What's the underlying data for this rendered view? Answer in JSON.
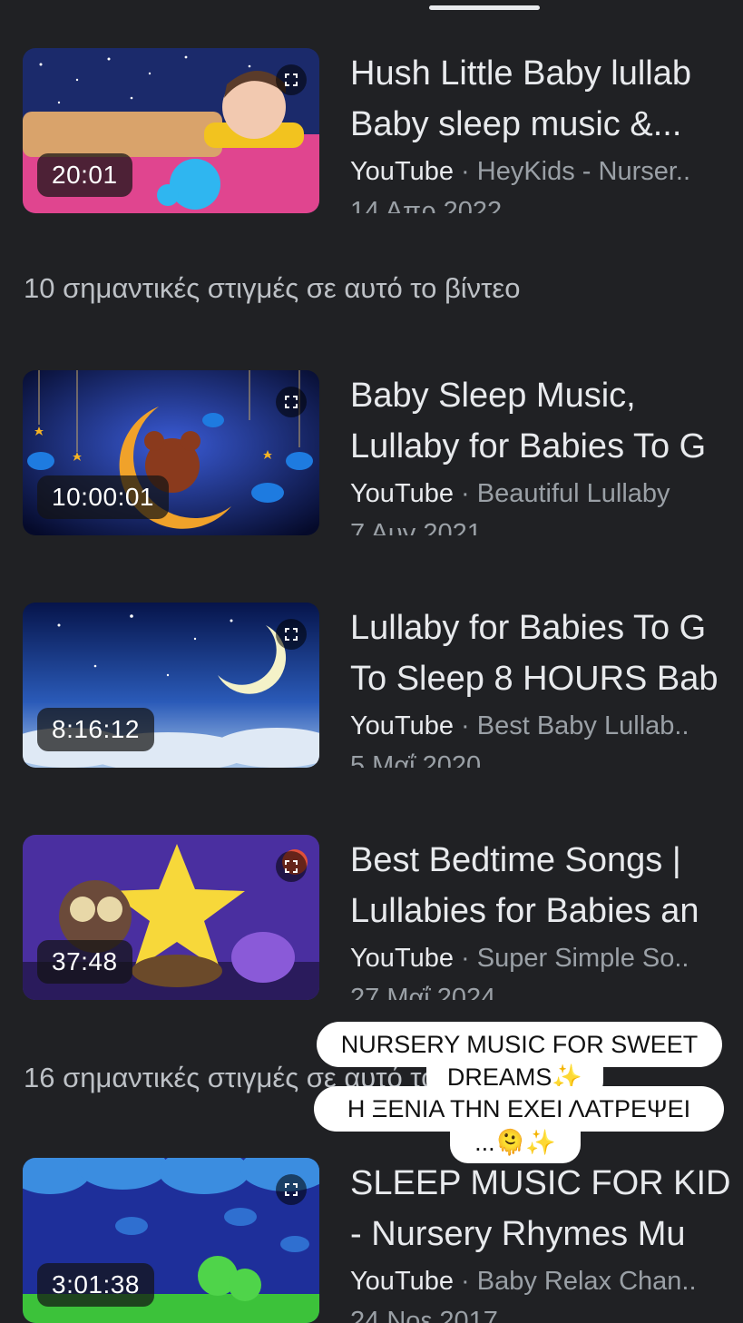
{
  "colors": {
    "background": "#202124",
    "title_text": "#e8eaed",
    "secondary_text": "#9aa0a6"
  },
  "icons": {
    "expand": "fullscreen-expand-icon"
  },
  "results": [
    {
      "duration": "20:01",
      "title_line1": "Hush Little Baby lullab",
      "title_line2": "Baby sleep music &...",
      "source": "YouTube",
      "channel": "· HeyKids - Nurser..",
      "date": "14 Απρ 2022"
    },
    {
      "duration": "10:00:01",
      "title_line1": "Baby Sleep Music,",
      "title_line2": "Lullaby for Babies To G",
      "source": "YouTube",
      "channel": "· Beautiful Lullaby",
      "date": "7 Αυγ 2021"
    },
    {
      "duration": "8:16:12",
      "title_line1": "Lullaby for Babies To G",
      "title_line2": "To Sleep 8 HOURS Bab",
      "source": "YouTube",
      "channel": "· Best Baby Lullab..",
      "date": "5 Μαΐ 2020"
    },
    {
      "duration": "37:48",
      "title_line1": "Best Bedtime Songs |",
      "title_line2": "Lullabies for Babies an",
      "source": "YouTube",
      "channel": "· Super Simple So..",
      "date": "27 Μαΐ 2024"
    },
    {
      "duration": "3:01:38",
      "title_line1": "SLEEP MUSIC FOR KID",
      "title_line2": "- Nursery Rhymes Mu",
      "source": "YouTube",
      "channel": "· Baby Relax Chan..",
      "date": "24 Νοε 2017"
    }
  ],
  "moments": [
    "10 σημαντικές στιγμές σε αυτό το βίντεο",
    "16 σημαντικές στιγμές σε αυτό το βίντεο"
  ],
  "sticker_lines": [
    "NURSERY MUSIC FOR SWEET",
    "DREAMS✨",
    "Η ΞΕΝΙΑ ΤΗΝ ΕΧΕΙ ΛΑΤΡΕΨΕΙ",
    "...🫠✨"
  ]
}
